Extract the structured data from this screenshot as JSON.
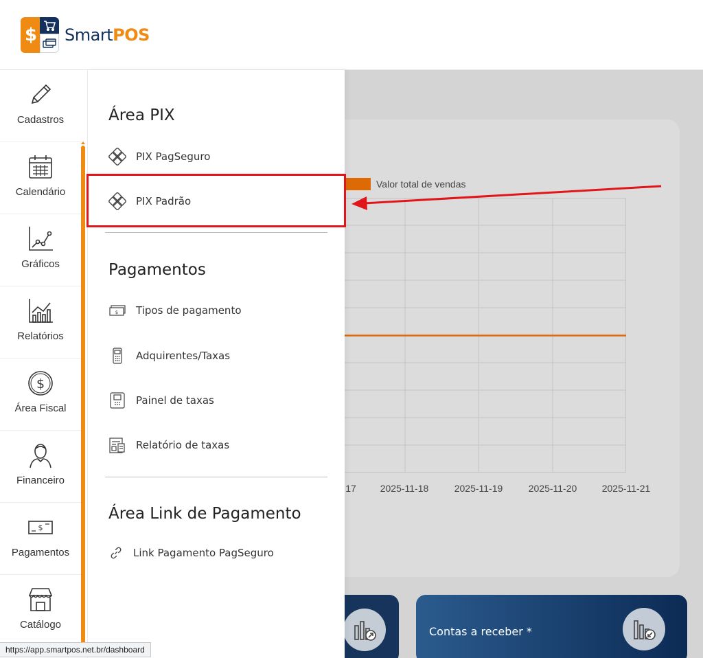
{
  "brand": {
    "name_part1": "Smart",
    "name_part2": "POS"
  },
  "rail": {
    "items": [
      {
        "label": "Cadastros",
        "icon": "pencil-icon"
      },
      {
        "label": "Calendário",
        "icon": "calendar-icon"
      },
      {
        "label": "Gráficos",
        "icon": "line-graph-icon"
      },
      {
        "label": "Relatórios",
        "icon": "bar-chart-icon"
      },
      {
        "label": "Área Fiscal",
        "icon": "dollar-circle-icon"
      },
      {
        "label": "Financeiro",
        "icon": "person-icon"
      },
      {
        "label": "Pagamentos",
        "icon": "banknote-icon"
      },
      {
        "label": "Catálogo",
        "icon": "storefront-icon"
      }
    ]
  },
  "flyout": {
    "pix": {
      "title": "Área PIX",
      "items": [
        {
          "label": "PIX PagSeguro",
          "icon": "pix-icon"
        },
        {
          "label": "PIX Padrão",
          "icon": "pix-icon"
        }
      ]
    },
    "pagamentos": {
      "title": "Pagamentos",
      "items": [
        {
          "label": "Tipos de pagamento",
          "icon": "cash-icon"
        },
        {
          "label": "Adquirentes/Taxas",
          "icon": "card-terminal-icon"
        },
        {
          "label": "Painel de taxas",
          "icon": "pos-machine-icon"
        },
        {
          "label": "Relatório de taxas",
          "icon": "receipt-report-icon"
        }
      ]
    },
    "link": {
      "title": "Área Link de Pagamento",
      "items": [
        {
          "label": "Link Pagamento PagSeguro",
          "icon": "link-icon"
        }
      ]
    }
  },
  "chart_data": {
    "type": "line",
    "legend": "Valor total de vendas",
    "x_tick_labels": [
      "17",
      "2025-11-18",
      "2025-11-19",
      "2025-11-20",
      "2025-11-21"
    ],
    "series_color": "#de6a06"
  },
  "cards": {
    "contas_receber": "Contas a receber *"
  },
  "statusbar": {
    "url": "https://app.smartpos.net.br/dashboard"
  },
  "colors": {
    "accent": "#ef8a12",
    "brand_navy": "#13315c",
    "annotation": "#e0161b"
  }
}
